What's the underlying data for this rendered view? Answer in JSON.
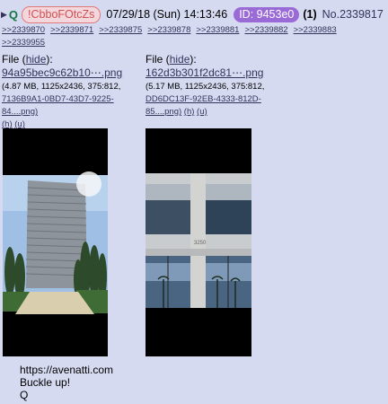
{
  "header": {
    "tripcode": "!CbboFOtcZs",
    "q_label": "Q",
    "datetime": "07/29/18 (Sun) 14:13:46",
    "id_badge": "ID: 9453e0",
    "count": "(1)",
    "post_no": "No.2339817"
  },
  "backlinks": [
    ">>2339870",
    ">>2339871",
    ">>2339875",
    ">>2339878",
    ">>2339881",
    ">>2339882",
    ">>2339883",
    ">>2339955"
  ],
  "files": [
    {
      "label": "File",
      "hide": "hide",
      "name": "94a95bec9c62b10⋯.png",
      "meta1": "(4.87 MB, 1125x2436, 375:812,",
      "meta2": "7136B9A1-0BD7-43D7-9225-84....png)",
      "h": "(h)",
      "u": "(u)"
    },
    {
      "label": "File",
      "hide": "hide",
      "name": "162d3b301f2dc81⋯.png",
      "meta1": "(5.17 MB, 1125x2436, 375:812,",
      "meta2": "DD6DC13F-92EB-4333-812D-",
      "meta3": "85....png)",
      "h": "(h)",
      "u": "(u)"
    }
  ],
  "message": {
    "line1": "https://avenatti.com",
    "line2": "Buckle up!",
    "line3": "Q"
  },
  "image1_building_number": "",
  "image2_building_number": "3250"
}
